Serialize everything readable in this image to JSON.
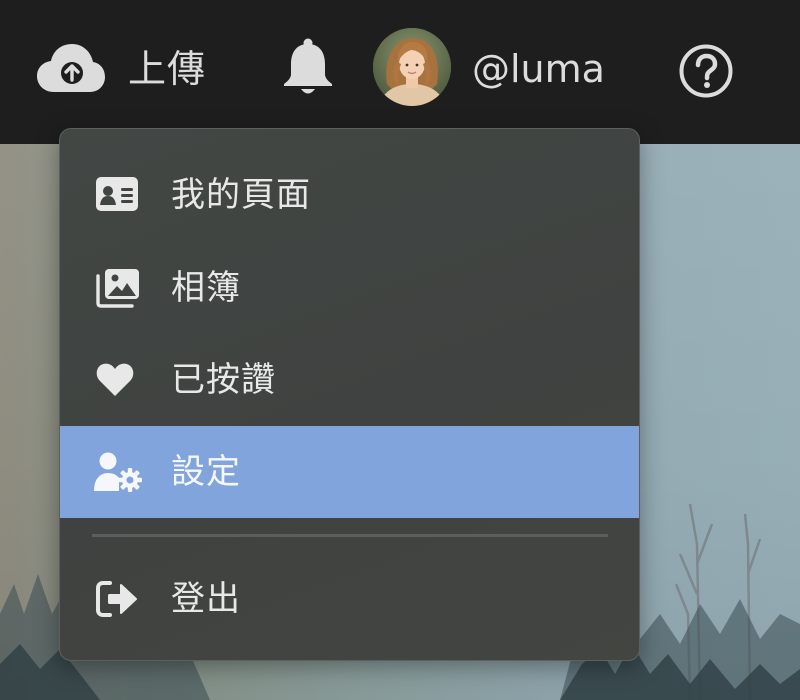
{
  "header": {
    "upload_label": "上傳",
    "username": "@luma"
  },
  "icons": {
    "upload": "cloud-upload-icon",
    "notifications": "bell-icon",
    "help": "question-circle-icon"
  },
  "user_menu": {
    "items": [
      {
        "label": "我的頁面",
        "icon": "id-card-icon"
      },
      {
        "label": "相簿",
        "icon": "photo-album-icon"
      },
      {
        "label": "已按讚",
        "icon": "heart-icon"
      },
      {
        "label": "設定",
        "icon": "user-gear-icon",
        "selected": true
      }
    ],
    "logout": {
      "label": "登出",
      "icon": "logout-icon"
    }
  },
  "colors": {
    "topbar": "#1e1e1e",
    "menu_bg": "#414542",
    "selected_item": "#82a4dc",
    "text": "#e8e8e8"
  }
}
